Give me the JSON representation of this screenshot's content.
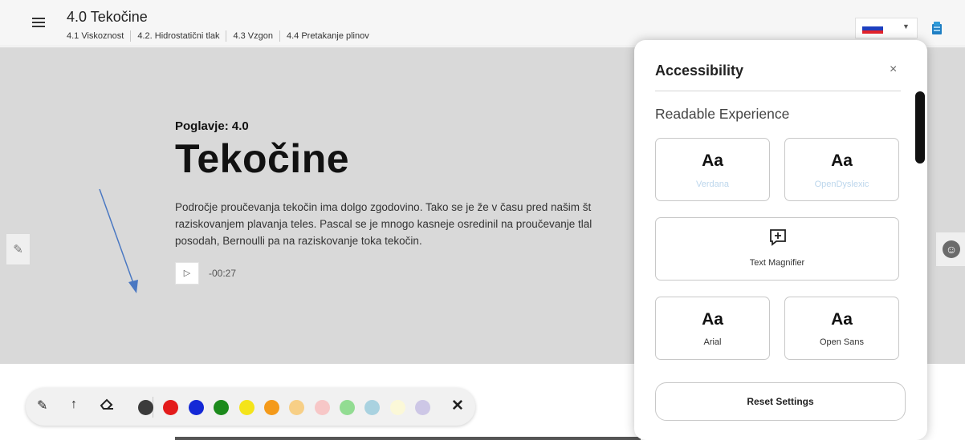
{
  "header": {
    "title": "4.0 Tekočine",
    "nav": [
      "4.1 Viskoznost",
      "4.2. Hidrostatični tlak",
      "4.3 Vzgon",
      "4.4 Pretakanje plinov"
    ],
    "language_flag": "slovenia-flag-icon"
  },
  "hero": {
    "chapter": "Poglavje: 4.0",
    "title": "Tekočine",
    "intro_lines": [
      "Področje proučevanja tekočin ima dolgo zgodovino. Tako se je že v času pred našim št",
      "raziskovanjem plavanja teles. Pascal se je mnogo kasneje osredinil na proučevanje tlal",
      "posodah, Bernoulli pa na raziskovanje toka tekočin."
    ],
    "audio_time": "-00:27"
  },
  "toolbar": {
    "colors": [
      "#3b3b3b",
      "#e31b1b",
      "#1428d6",
      "#1c8a1c",
      "#f4e41a",
      "#f49a1a",
      "#f7cf86",
      "#f7c7c7",
      "#92dc92",
      "#a9d2e0",
      "#fbf8d8",
      "#cdc7e6"
    ]
  },
  "accessibility": {
    "title": "Accessibility",
    "close": "×",
    "section": "Readable Experience",
    "options": [
      {
        "aa": "Aa",
        "label": "Verdana"
      },
      {
        "aa": "Aa",
        "label": "OpenDyslexic"
      },
      {
        "aa": "",
        "label": "Text Magnifier"
      },
      {
        "aa": "Aa",
        "label": "Arial"
      },
      {
        "aa": "Aa",
        "label": "Open Sans"
      }
    ],
    "reset": "Reset Settings"
  }
}
